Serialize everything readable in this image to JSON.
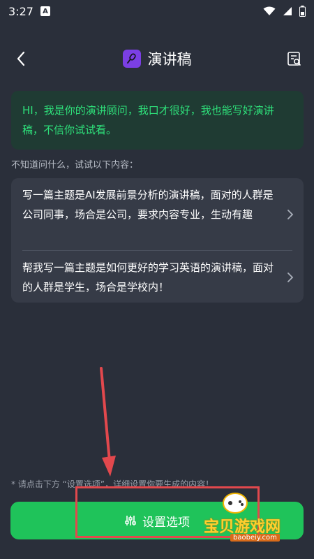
{
  "status_bar": {
    "time": "3:27",
    "sim_badge": "A"
  },
  "header": {
    "title": "演讲稿",
    "back_icon": "chevron-left-icon",
    "history_icon": "history-search-icon",
    "app_icon": "microphone-icon"
  },
  "chat": {
    "greeting": "HI，我是你的演讲顾问，我口才很好，我也能写好演讲稿，不信你试试看。"
  },
  "suggestions": {
    "hint": "不知道问什么，试试以下内容：",
    "items": [
      {
        "text": "写一篇主题是AI发展前景分析的演讲稿，面对的人群是公司同事，场合是公司，要求内容专业，生动有趣"
      },
      {
        "text": "帮我写一篇主题是如何更好的学习英语的演讲稿，面对的人群是学生，场合是学校内！"
      }
    ]
  },
  "footer": {
    "note": "* 请点击下方 “设置选项”，详细设置你要生成的内容！",
    "button_label": "设置选项",
    "button_icon": "sliders-icon"
  },
  "watermark": {
    "text": "宝贝游戏网",
    "url": "baobeiy.com"
  },
  "colors": {
    "background": "#2a2f3a",
    "accent_green": "#1fc35a",
    "bubble_text": "#2ee07a",
    "annotation_red": "#e2484d"
  }
}
